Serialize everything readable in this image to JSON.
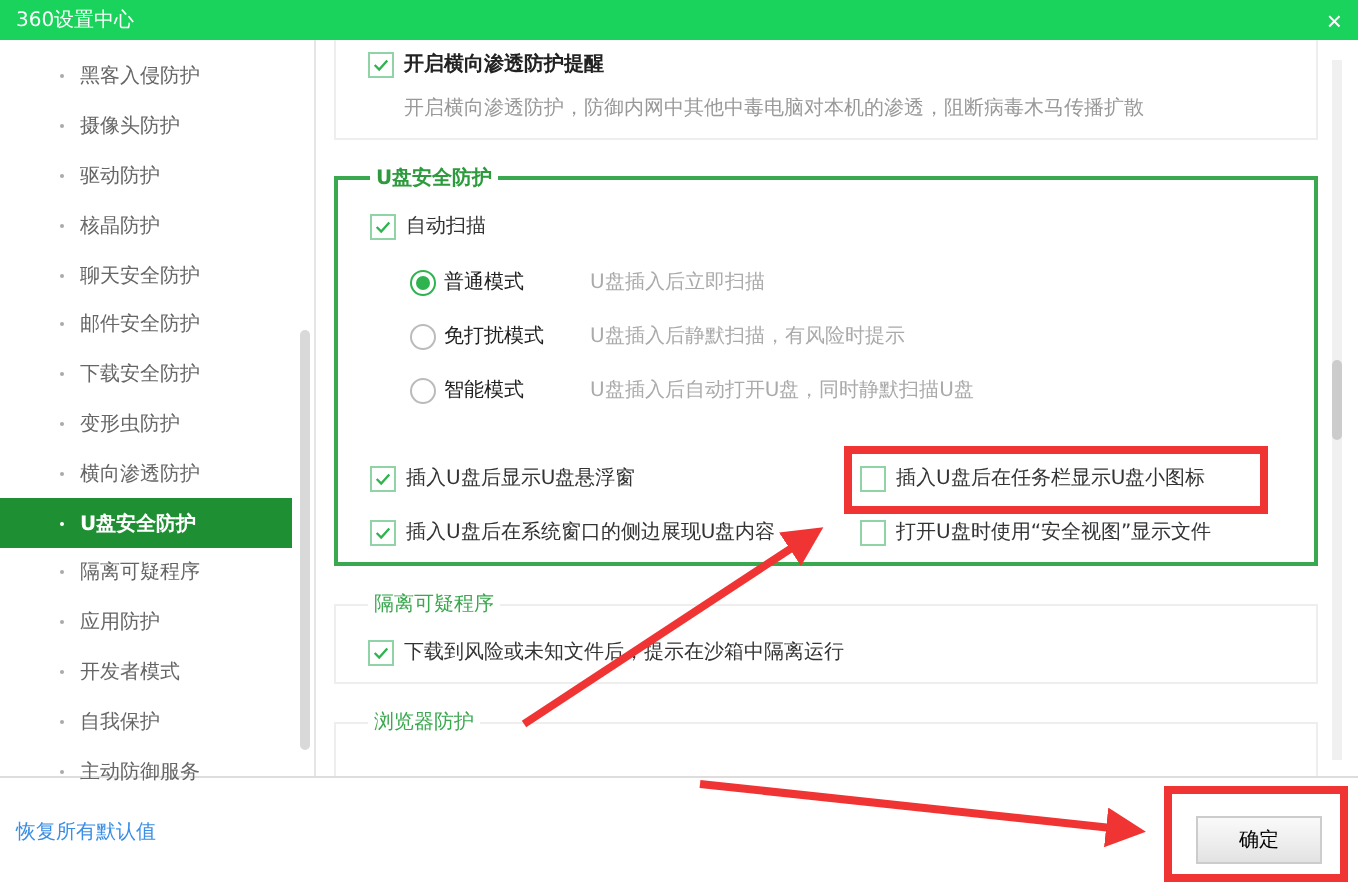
{
  "window": {
    "title": "360设置中心",
    "close": "×"
  },
  "sidebar": {
    "items": [
      {
        "label": "黑客入侵防护",
        "selected": false
      },
      {
        "label": "摄像头防护",
        "selected": false
      },
      {
        "label": "驱动防护",
        "selected": false
      },
      {
        "label": "核晶防护",
        "selected": false
      },
      {
        "label": "聊天安全防护",
        "selected": false
      },
      {
        "label": "邮件安全防护",
        "selected": false
      },
      {
        "label": "下载安全防护",
        "selected": false
      },
      {
        "label": "变形虫防护",
        "selected": false
      },
      {
        "label": "横向渗透防护",
        "selected": false
      },
      {
        "label": "U盘安全防护",
        "selected": true
      },
      {
        "label": "隔离可疑程序",
        "selected": false
      },
      {
        "label": "应用防护",
        "selected": false
      },
      {
        "label": "开发者模式",
        "selected": false
      },
      {
        "label": "自我保护",
        "selected": false
      },
      {
        "label": "主动防御服务",
        "selected": false
      }
    ]
  },
  "top_card": {
    "checkbox": {
      "label": "开启横向渗透防护提醒",
      "checked": true
    },
    "description": "开启横向渗透防护，防御内网中其他中毒电脑对本机的渗透，阻断病毒木马传播扩散"
  },
  "usb_section": {
    "title": "U盘安全防护",
    "auto_scan": {
      "label": "自动扫描",
      "checked": true
    },
    "modes": [
      {
        "label": "普通模式",
        "hint": "U盘插入后立即扫描",
        "selected": true
      },
      {
        "label": "免打扰模式",
        "hint": "U盘插入后静默扫描，有风险时提示",
        "selected": false
      },
      {
        "label": "智能模式",
        "hint": "U盘插入后自动打开U盘，同时静默扫描U盘",
        "selected": false
      }
    ],
    "options": [
      {
        "label": "插入U盘后显示U盘悬浮窗",
        "checked": true
      },
      {
        "label": "插入U盘后在任务栏显示U盘小图标",
        "checked": false
      },
      {
        "label": "插入U盘后在系统窗口的侧边展现U盘内容",
        "checked": true
      },
      {
        "label": "打开U盘时使用“安全视图”显示文件",
        "checked": false
      }
    ]
  },
  "isolation_section": {
    "title": "隔离可疑程序",
    "option": {
      "label": "下载到风险或未知文件后，提示在沙箱中隔离运行",
      "checked": true
    }
  },
  "browser_section": {
    "title": "浏览器防护"
  },
  "footer": {
    "restore_link": "恢复所有默认值",
    "ok_button": "确定"
  }
}
